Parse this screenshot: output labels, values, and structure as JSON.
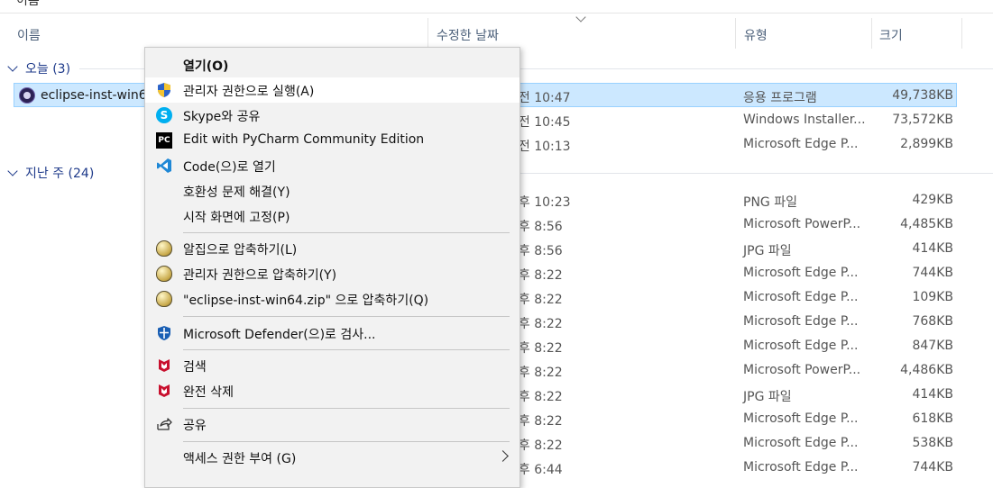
{
  "header": {
    "cut_label": "이름",
    "columns": {
      "name": "이름",
      "date": "수정한 날짜",
      "type": "유형",
      "size": "크기"
    }
  },
  "groups": {
    "today": "오늘 (3)",
    "last_week": "지난 주 (24)"
  },
  "selected_file": {
    "name": "eclipse-inst-win64"
  },
  "rows": [
    {
      "date": "오전 10:47",
      "type": "응용 프로그램",
      "size": "49,738KB"
    },
    {
      "date": "오전 10:45",
      "type": "Windows Installer...",
      "size": "73,572KB"
    },
    {
      "date": "오전 10:13",
      "type": "Microsoft Edge P...",
      "size": "2,899KB"
    },
    {
      "date": "오후 10:23",
      "type": "PNG 파일",
      "size": "429KB"
    },
    {
      "date": "오후 8:56",
      "type": "Microsoft PowerP...",
      "size": "4,485KB"
    },
    {
      "date": "오후 8:56",
      "type": "JPG 파일",
      "size": "414KB"
    },
    {
      "date": "오후 8:22",
      "type": "Microsoft Edge P...",
      "size": "744KB"
    },
    {
      "date": "오후 8:22",
      "type": "Microsoft Edge P...",
      "size": "109KB"
    },
    {
      "date": "오후 8:22",
      "type": "Microsoft Edge P...",
      "size": "768KB"
    },
    {
      "date": "오후 8:22",
      "type": "Microsoft Edge P...",
      "size": "847KB"
    },
    {
      "date": "오후 8:22",
      "type": "Microsoft PowerP...",
      "size": "4,486KB"
    },
    {
      "date": "오후 8:22",
      "type": "JPG 파일",
      "size": "414KB"
    },
    {
      "date": "오후 8:22",
      "type": "Microsoft Edge P...",
      "size": "618KB"
    },
    {
      "date": "오후 8:22",
      "type": "Microsoft Edge P...",
      "size": "538KB"
    },
    {
      "date": "오후 6:44",
      "type": "Microsoft Edge P...",
      "size": "744KB"
    }
  ],
  "context_menu": {
    "open": "열기(O)",
    "run_as_admin": "관리자 권한으로 실행(A)",
    "skype_share": "Skype와 공유",
    "pycharm_edit": "Edit with PyCharm Community Edition",
    "code_open": "Code(으)로 열기",
    "troubleshoot": "호환성 문제 해결(Y)",
    "pin_start": "시작 화면에 고정(P)",
    "alzip_compress": "알집으로 압축하기(L)",
    "admin_compress": "관리자 권한으로 압축하기(Y)",
    "compress_to_zip": "\"eclipse-inst-win64.zip\" 으로 압축하기(Q)",
    "defender_scan": "Microsoft Defender(으)로 검사...",
    "search": "검색",
    "shred": "완전 삭제",
    "share": "공유",
    "give_access": "액세스 권한 부여 (G)"
  },
  "icons": {
    "uac_shield": "uac-shield-icon",
    "skype": "skype-icon",
    "pycharm": "pycharm-icon",
    "vscode": "vscode-icon",
    "alzip": "alzip-icon",
    "defender": "defender-icon",
    "mcafee": "mcafee-icon",
    "share": "share-icon"
  },
  "colors": {
    "selection_bg": "#cce8ff",
    "selection_border": "#99d1ff",
    "header_text": "#4c607a",
    "group_text": "#1e3a8a",
    "menu_bg": "#f2f2f2"
  }
}
